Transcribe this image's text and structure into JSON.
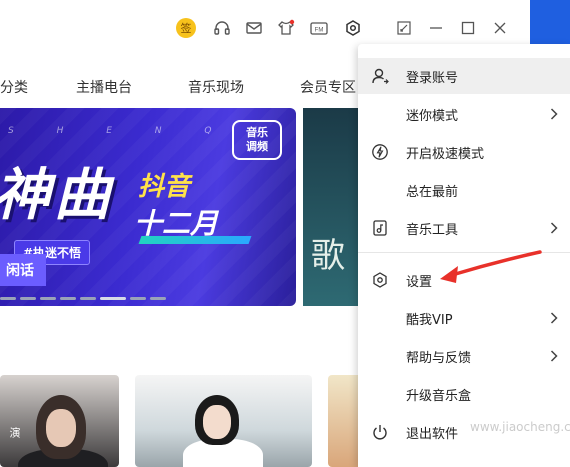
{
  "titlebar": {
    "sign_label": "签",
    "icons": [
      "headphones-icon",
      "mail-icon",
      "shirt-icon",
      "fm-radio-icon",
      "settings-hex-icon",
      "mini-mode-icon",
      "minimize-icon",
      "maximize-icon",
      "close-icon"
    ],
    "fm_label": "FM"
  },
  "nav": {
    "items": [
      "分类",
      "主播电台",
      "音乐现场",
      "会员专区"
    ]
  },
  "banner": {
    "letters": "S H E N Q U",
    "main_title": "神曲",
    "douyin": "抖音",
    "month": "十二月",
    "tag": "#执迷不悟",
    "chat": "闲话",
    "logo_line1": "音乐",
    "logo_line2": "调频",
    "dots_count": 8,
    "active_dot_index": 5
  },
  "banner2": {
    "text": "歌"
  },
  "thumbs": {
    "thumb1_text": "演"
  },
  "menu": {
    "items": [
      {
        "label": "登录账号",
        "icon": "user-icon",
        "has_submenu": false
      },
      {
        "label": "迷你模式",
        "icon": "",
        "has_submenu": true
      },
      {
        "label": "开启极速模式",
        "icon": "lightning-icon",
        "has_submenu": false
      },
      {
        "label": "总在最前",
        "icon": "",
        "has_submenu": false
      },
      {
        "label": "音乐工具",
        "icon": "music-file-icon",
        "has_submenu": true
      },
      {
        "label": "设置",
        "icon": "settings-hex-icon",
        "has_submenu": false
      },
      {
        "label": "酷我VIP",
        "icon": "",
        "has_submenu": true
      },
      {
        "label": "帮助与反馈",
        "icon": "",
        "has_submenu": true
      },
      {
        "label": "升级音乐盒",
        "icon": "",
        "has_submenu": false
      },
      {
        "label": "退出软件",
        "icon": "power-icon",
        "has_submenu": false
      }
    ]
  },
  "colors": {
    "accent_blue": "#1f5fe0",
    "sign_yellow": "#f7c21c",
    "annotation_red": "#e8312a",
    "menu_hover": "#efefef"
  },
  "watermark": "www.jiaocheng.com"
}
